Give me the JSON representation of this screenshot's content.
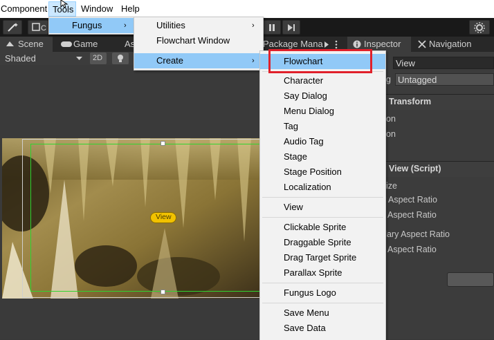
{
  "menubar": {
    "items": [
      "Component",
      "Tools",
      "Window",
      "Help"
    ]
  },
  "tabs": {
    "scene": "Scene",
    "game": "Game",
    "asset_partial": "As",
    "package_manager": "Package Mana",
    "inspector": "Inspector",
    "navigation": "Navigation"
  },
  "scene_toolbar": {
    "shading_mode": "Shaded",
    "mode_2d": "2D"
  },
  "scene": {
    "view_label": "View"
  },
  "inspector": {
    "object_name": "View",
    "tag_label_partial": "g",
    "tag_value": "Untagged",
    "transform_section": "Transform",
    "row1_partial": "on",
    "row2_partial": "on",
    "script_section": "View (Script)",
    "size_partial": "ize",
    "aspect1": "y Aspect Ratio",
    "aspect2": "Aspect Ratio",
    "aspect3": "dary Aspect Ratio",
    "aspect4": "Aspect Ratio"
  },
  "tools_menu": {
    "fungus": "Fungus"
  },
  "fungus_menu": {
    "items": [
      "Utilities",
      "Flowchart Window",
      "Create"
    ]
  },
  "create_menu": {
    "items": [
      "Flowchart",
      "Character",
      "Say Dialog",
      "Menu Dialog",
      "Tag",
      "Audio Tag",
      "Stage",
      "Stage Position",
      "Localization",
      "View",
      "Clickable Sprite",
      "Draggable Sprite",
      "Drag Target Sprite",
      "Parallax Sprite",
      "Fungus Logo",
      "Save Menu",
      "Save Data"
    ]
  },
  "colors": {
    "highlight_box": "#e0202a",
    "menu_highlight": "#91c9f7",
    "selection_frame": "#2fd42f",
    "view_label_bg": "#f2c200"
  }
}
